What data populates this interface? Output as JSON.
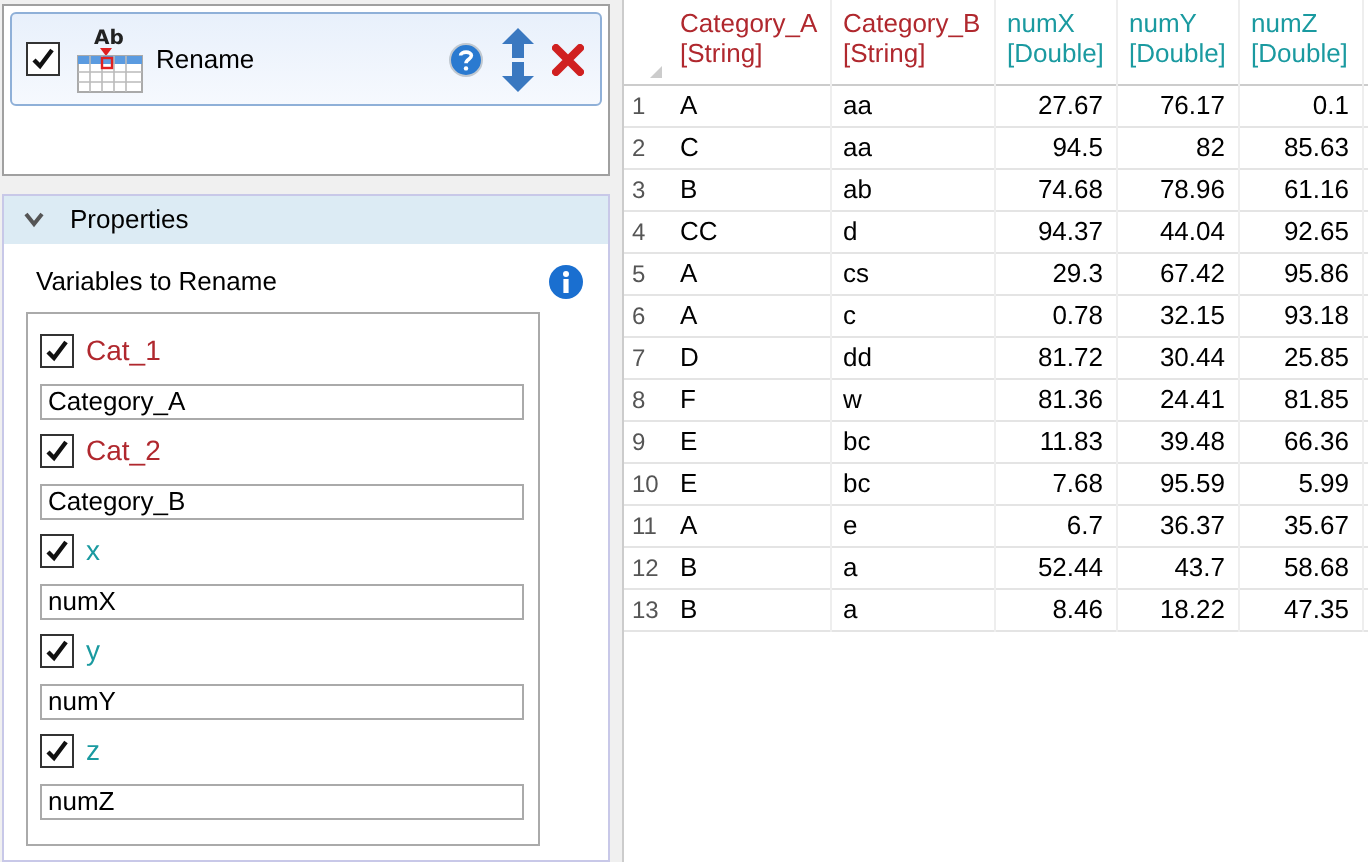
{
  "step": {
    "checked": true,
    "icon_text": "Ab",
    "title": "Rename"
  },
  "properties": {
    "title": "Properties",
    "expanded": true,
    "section_label": "Variables to Rename",
    "variables": [
      {
        "name": "Cat_1",
        "kind": "string",
        "checked": true,
        "value": "Category_A"
      },
      {
        "name": "Cat_2",
        "kind": "string",
        "checked": true,
        "value": "Category_B"
      },
      {
        "name": "x",
        "kind": "double",
        "checked": true,
        "value": "numX"
      },
      {
        "name": "y",
        "kind": "double",
        "checked": true,
        "value": "numY"
      },
      {
        "name": "z",
        "kind": "double",
        "checked": true,
        "value": "numZ"
      }
    ]
  },
  "table": {
    "columns": [
      {
        "name": "Category_A",
        "type": "[String]",
        "kind": "string"
      },
      {
        "name": "Category_B",
        "type": "[String]",
        "kind": "string"
      },
      {
        "name": "numX",
        "type": "[Double]",
        "kind": "double"
      },
      {
        "name": "numY",
        "type": "[Double]",
        "kind": "double"
      },
      {
        "name": "numZ",
        "type": "[Double]",
        "kind": "double"
      }
    ],
    "rows": [
      {
        "number": "1",
        "cells": [
          "A",
          "aa",
          "27.67",
          "76.17",
          "0.1"
        ]
      },
      {
        "number": "2",
        "cells": [
          "C",
          "aa",
          "94.5",
          "82",
          "85.63"
        ]
      },
      {
        "number": "3",
        "cells": [
          "B",
          "ab",
          "74.68",
          "78.96",
          "61.16"
        ]
      },
      {
        "number": "4",
        "cells": [
          "CC",
          "d",
          "94.37",
          "44.04",
          "92.65"
        ]
      },
      {
        "number": "5",
        "cells": [
          "A",
          "cs",
          "29.3",
          "67.42",
          "95.86"
        ]
      },
      {
        "number": "6",
        "cells": [
          "A",
          "c",
          "0.78",
          "32.15",
          "93.18"
        ]
      },
      {
        "number": "7",
        "cells": [
          "D",
          "dd",
          "81.72",
          "30.44",
          "25.85"
        ]
      },
      {
        "number": "8",
        "cells": [
          "F",
          "w",
          "81.36",
          "24.41",
          "81.85"
        ]
      },
      {
        "number": "9",
        "cells": [
          "E",
          "bc",
          "11.83",
          "39.48",
          "66.36"
        ]
      },
      {
        "number": "10",
        "cells": [
          "E",
          "bc",
          "7.68",
          "95.59",
          "5.99"
        ]
      },
      {
        "number": "11",
        "cells": [
          "A",
          "e",
          "6.7",
          "36.37",
          "35.67"
        ]
      },
      {
        "number": "12",
        "cells": [
          "B",
          "a",
          "52.44",
          "43.7",
          "58.68"
        ]
      },
      {
        "number": "13",
        "cells": [
          "B",
          "a",
          "8.46",
          "18.22",
          "47.35"
        ]
      }
    ]
  }
}
